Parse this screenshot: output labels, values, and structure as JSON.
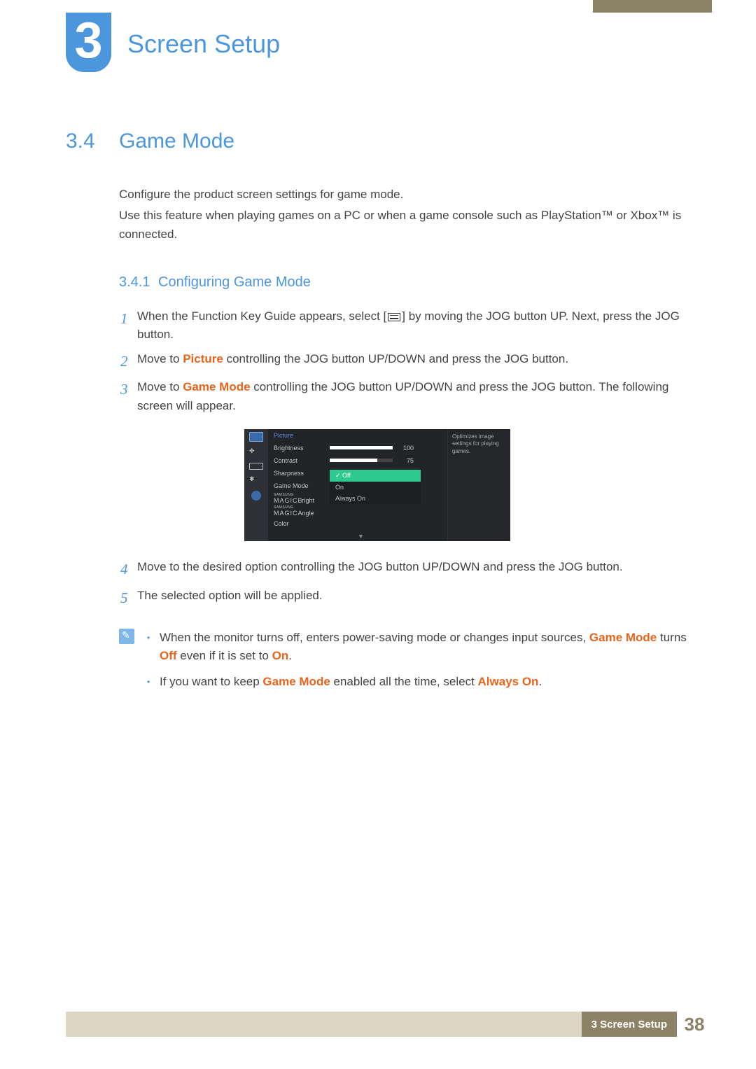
{
  "chapter": {
    "number": "3",
    "title": "Screen Setup"
  },
  "section": {
    "number": "3.4",
    "title": "Game Mode",
    "intro1": "Configure the product screen settings for game mode.",
    "intro2": "Use this feature when playing games on a PC or when a game console such as PlayStation™ or Xbox™ is connected."
  },
  "subsection": {
    "number": "3.4.1",
    "title": "Configuring Game Mode"
  },
  "steps": {
    "s1a": "When the Function Key Guide appears, select [",
    "s1b": "] by moving the JOG button UP. Next, press the JOG button.",
    "s2a": "Move to ",
    "s2b": " controlling the JOG button UP/DOWN and press the JOG button.",
    "s3a": "Move to ",
    "s3b": " controlling the JOG button UP/DOWN and press the JOG button. The following screen will appear.",
    "s4": "Move to the desired option controlling the JOG button UP/DOWN and press the JOG button.",
    "s5": "The selected option will be applied."
  },
  "terms": {
    "picture": "Picture",
    "gameMode": "Game Mode",
    "off": "Off",
    "on": "On",
    "alwaysOn": "Always On"
  },
  "osd": {
    "header": "Picture",
    "brightness": "Brightness",
    "contrast": "Contrast",
    "sharpness": "Sharpness",
    "gameMode": "Game Mode",
    "magicBright": "Bright",
    "magicAngle": "Angle",
    "magic": "MAGIC",
    "samsung": "SAMSUNG",
    "color": "Color",
    "brightVal": "100",
    "contrastVal": "75",
    "optOff": "Off",
    "optOn": "On",
    "optAlways": "Always On",
    "tip": "Optimizes image settings for playing games."
  },
  "notes": {
    "n1a": "When the monitor turns off, enters power-saving mode or changes input sources, ",
    "n1b": " turns ",
    "n1c": " even if it is set to ",
    "n1d": ".",
    "n2a": "If you want to keep ",
    "n2b": " enabled all the time, select ",
    "n2c": "."
  },
  "footer": {
    "label": "3 Screen Setup",
    "page": "38"
  }
}
